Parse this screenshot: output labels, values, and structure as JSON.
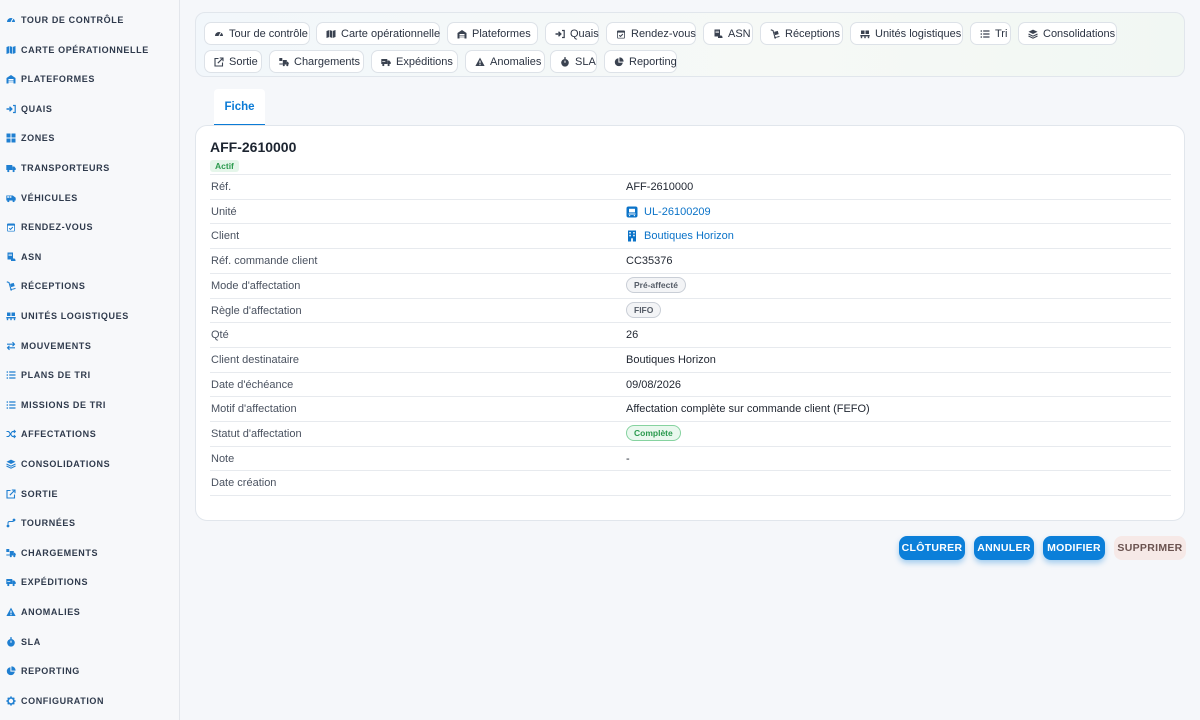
{
  "sidebar": {
    "items": [
      {
        "label": "TOUR DE CONTRÔLE",
        "icon": "gauge-icon"
      },
      {
        "label": "CARTE OPÉRATIONNELLE",
        "icon": "map-icon"
      },
      {
        "label": "PLATEFORMES",
        "icon": "warehouse-icon"
      },
      {
        "label": "QUAIS",
        "icon": "dock-in-icon"
      },
      {
        "label": "ZONES",
        "icon": "grid-icon"
      },
      {
        "label": "TRANSPORTEURS",
        "icon": "truck-icon"
      },
      {
        "label": "VÉHICULES",
        "icon": "van-icon"
      },
      {
        "label": "RENDEZ-VOUS",
        "icon": "calendar-check-icon"
      },
      {
        "label": "ASN",
        "icon": "document-truck-icon"
      },
      {
        "label": "RÉCEPTIONS",
        "icon": "dolly-icon"
      },
      {
        "label": "UNITÉS LOGISTIQUES",
        "icon": "pallet-icon"
      },
      {
        "label": "MOUVEMENTS",
        "icon": "arrows-exchange-icon"
      },
      {
        "label": "PLANS DE TRI",
        "icon": "list-icon"
      },
      {
        "label": "MISSIONS DE TRI",
        "icon": "list-icon"
      },
      {
        "label": "AFFECTATIONS",
        "icon": "shuffle-icon"
      },
      {
        "label": "CONSOLIDATIONS",
        "icon": "layers-icon"
      },
      {
        "label": "SORTIE",
        "icon": "export-icon"
      },
      {
        "label": "TOURNÉES",
        "icon": "route-icon"
      },
      {
        "label": "CHARGEMENTS",
        "icon": "truck-loading-icon"
      },
      {
        "label": "EXPÉDITIONS",
        "icon": "shipping-icon"
      },
      {
        "label": "ANOMALIES",
        "icon": "warning-icon"
      },
      {
        "label": "SLA",
        "icon": "stopwatch-icon"
      },
      {
        "label": "REPORTING",
        "icon": "pie-chart-icon"
      },
      {
        "label": "CONFIGURATION",
        "icon": "gear-icon"
      }
    ]
  },
  "quicknav": {
    "buttons": [
      {
        "label": "Tour de contrôle",
        "icon": "gauge-icon"
      },
      {
        "label": "Carte opérationnelle",
        "icon": "map-icon"
      },
      {
        "label": "Plateformes",
        "icon": "warehouse-icon"
      },
      {
        "label": "Quais",
        "icon": "dock-in-icon"
      },
      {
        "label": "Rendez-vous",
        "icon": "calendar-check-icon"
      },
      {
        "label": "ASN",
        "icon": "document-truck-icon"
      },
      {
        "label": "Réceptions",
        "icon": "dolly-icon"
      },
      {
        "label": "Unités logistiques",
        "icon": "pallet-icon"
      },
      {
        "label": "Tri",
        "icon": "list-icon"
      },
      {
        "label": "Consolidations",
        "icon": "layers-icon"
      },
      {
        "label": "Sortie",
        "icon": "export-icon"
      },
      {
        "label": "Chargements",
        "icon": "truck-loading-icon"
      },
      {
        "label": "Expéditions",
        "icon": "shipping-icon"
      },
      {
        "label": "Anomalies",
        "icon": "warning-icon"
      },
      {
        "label": "SLA",
        "icon": "stopwatch-icon"
      },
      {
        "label": "Reporting",
        "icon": "pie-chart-icon"
      }
    ]
  },
  "tabs": {
    "active": "Fiche"
  },
  "record": {
    "title": "AFF-2610000",
    "status_badge": "Actif",
    "fields": [
      {
        "label": "Réf.",
        "value": "AFF-2610000",
        "kind": "text"
      },
      {
        "label": "Unité",
        "value": "UL-26100209",
        "kind": "link",
        "icon": "pallet-box-icon"
      },
      {
        "label": "Client",
        "value": "Boutiques Horizon",
        "kind": "link",
        "icon": "building-icon"
      },
      {
        "label": "Réf. commande client",
        "value": "CC35376",
        "kind": "text"
      },
      {
        "label": "Mode d'affectation",
        "value": "Pré-affecté",
        "kind": "pill"
      },
      {
        "label": "Règle d'affectation",
        "value": "FIFO",
        "kind": "pill"
      },
      {
        "label": "Qté",
        "value": "26",
        "kind": "text"
      },
      {
        "label": "Client destinataire",
        "value": "Boutiques Horizon",
        "kind": "text"
      },
      {
        "label": "Date d'échéance",
        "value": "09/08/2026",
        "kind": "text"
      },
      {
        "label": "Motif d'affectation",
        "value": "Affectation complète sur commande client (FEFO)",
        "kind": "text"
      },
      {
        "label": "Statut d'affectation",
        "value": "Complète",
        "kind": "pill-green"
      },
      {
        "label": "Note",
        "value": "-",
        "kind": "dash"
      },
      {
        "label": "Date création",
        "value": "",
        "kind": "text"
      }
    ]
  },
  "actions": {
    "close_label": "CLÔTURER",
    "cancel_label": "ANNULER",
    "edit_label": "MODIFIER",
    "delete_label": "SUPPRIMER"
  },
  "colors": {
    "accent": "#0b7fd9",
    "link": "#0b73c8",
    "success": "#2a9a4e",
    "sidebar_icon": "#1f7fd1"
  }
}
